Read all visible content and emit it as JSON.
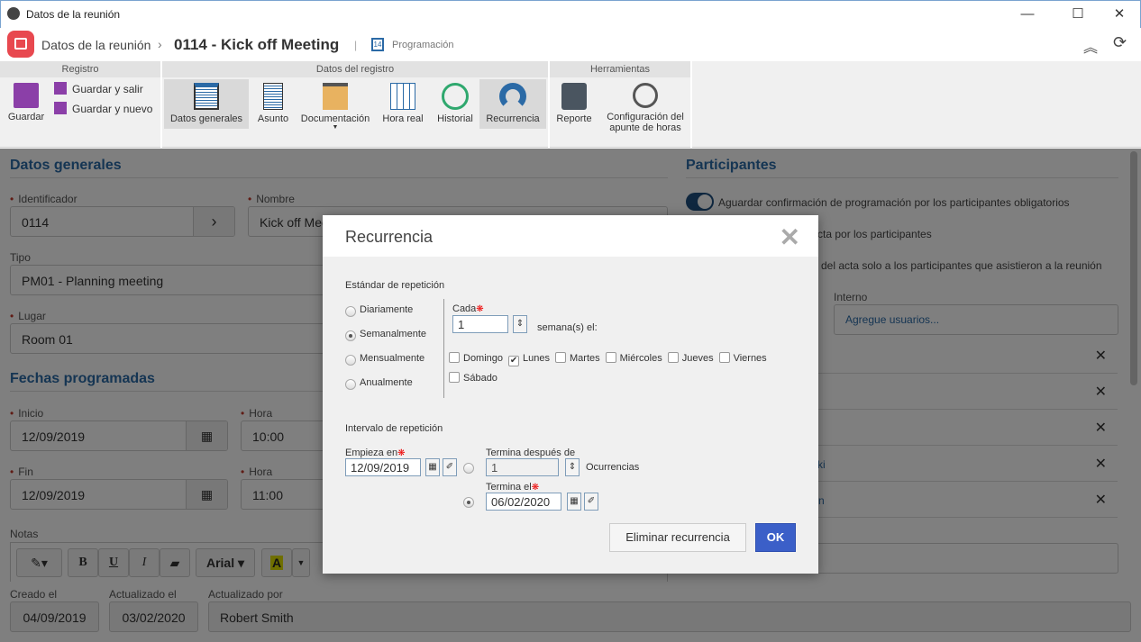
{
  "window": {
    "title": "Datos de la reunión",
    "minimize": "—",
    "maximize": "☐",
    "close": "✕"
  },
  "header": {
    "breadcrumb": "Datos de la reunión",
    "title": "0114 - Kick off Meeting",
    "separator": "|",
    "module": "Programación",
    "calendar_day": "14"
  },
  "toolbar": {
    "groups": [
      "Registro",
      "Datos del registro",
      "Herramientas"
    ],
    "guardar": "Guardar",
    "guardar_salir": "Guardar y salir",
    "guardar_nuevo": "Guardar y nuevo",
    "items": [
      "Datos generales",
      "Asunto",
      "Documentación",
      "Hora real",
      "Historial",
      "Recurrencia"
    ],
    "reporte": "Reporte",
    "config1": "Configuración del",
    "config2": "apunte de horas"
  },
  "general": {
    "title": "Datos generales",
    "identificador_label": "Identificador",
    "identificador": "0114",
    "nombre_label": "Nombre",
    "nombre": "Kick off Meeting",
    "tipo_label": "Tipo",
    "tipo": "PM01 - Planning meeting",
    "lugar_label": "Lugar",
    "lugar": "Room 01"
  },
  "fechas": {
    "title": "Fechas programadas",
    "inicio_label": "Inicio",
    "inicio": "12/09/2019",
    "hora_label": "Hora",
    "hora_inicio": "10:00",
    "fin_label": "Fin",
    "fin": "12/09/2019",
    "hora_fin": "11:00"
  },
  "notas": {
    "label": "Notas",
    "bold": "B",
    "underline": "U",
    "italic": "I",
    "font": "Arial ▾",
    "color": "A"
  },
  "audit": {
    "creado_label": "Creado el",
    "creado": "04/09/2019",
    "actualizado_label": "Actualizado el",
    "actualizado": "03/02/2020",
    "por_label": "Actualizado por",
    "por": "Robert Smith"
  },
  "participantes": {
    "title": "Participantes",
    "opt1": "Aguardar confirmación de programación por los participantes obligatorios",
    "opt2": "cta por los participantes",
    "opt3": "del acta solo a los participantes que asistieron a la reunión",
    "interno_label": "Interno",
    "interno_placeholder": "Agregue usuarios...",
    "row_fragments": [
      "",
      "",
      "",
      "ki",
      "n"
    ]
  },
  "modal": {
    "title": "Recurrencia",
    "close": "✕",
    "std_title": "Estándar de repetición",
    "options": [
      "Diariamente",
      "Semanalmente",
      "Mensualmente",
      "Anualmente"
    ],
    "selected": "Semanalmente",
    "cada_label": "Cada",
    "cada": "1",
    "semanas": "semana(s) el:",
    "days": [
      {
        "label": "Domingo",
        "checked": false
      },
      {
        "label": "Lunes",
        "checked": true
      },
      {
        "label": "Martes",
        "checked": false
      },
      {
        "label": "Miércoles",
        "checked": false
      },
      {
        "label": "Jueves",
        "checked": false
      },
      {
        "label": "Viernes",
        "checked": false
      },
      {
        "label": "Sábado",
        "checked": false
      }
    ],
    "interval_title": "Intervalo de repetición",
    "empieza_label": "Empieza en",
    "empieza": "12/09/2019",
    "termina_despues_label": "Termina después de",
    "ocurrencias": "1",
    "ocurrencias_label": "Ocurrencias",
    "termina_el_label": "Termina el",
    "termina_el": "06/02/2020",
    "end_mode": "termina_el",
    "delete": "Eliminar recurrencia",
    "ok": "OK"
  },
  "colors": {
    "accent": "#2b6aa6",
    "ok": "#3b5fc8",
    "logo": "#e8484f"
  }
}
